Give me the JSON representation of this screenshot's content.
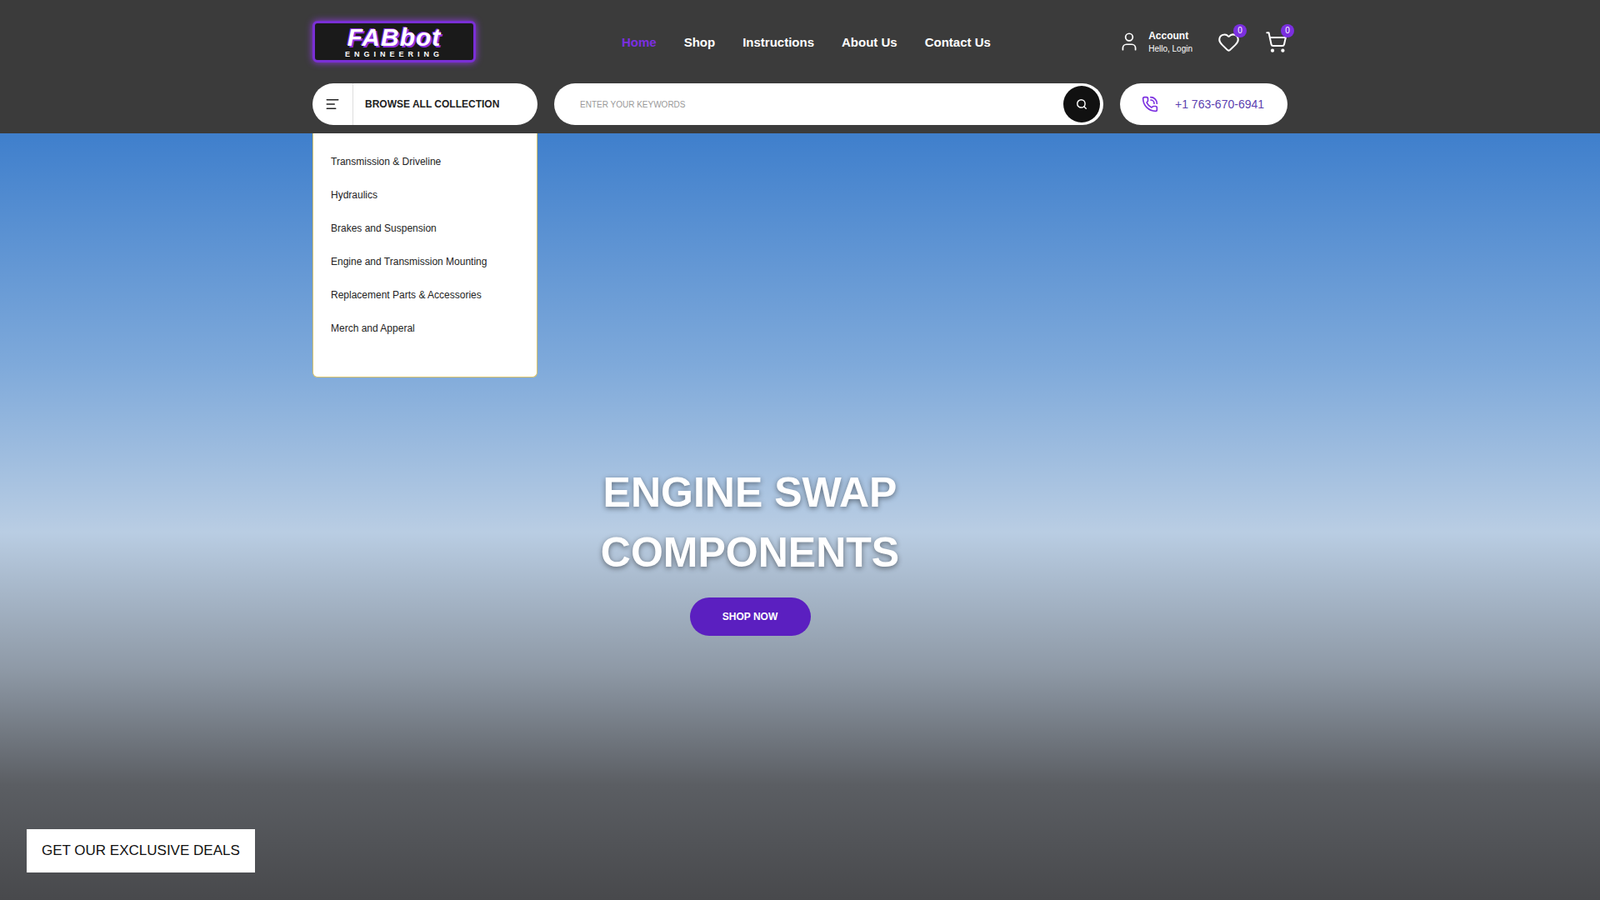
{
  "logo": {
    "text": "FABbot",
    "subtitle": "ENGINEERING"
  },
  "nav": [
    {
      "label": "Home",
      "selected": true
    },
    {
      "label": "Shop",
      "selected": false
    },
    {
      "label": "Instructions",
      "selected": false
    },
    {
      "label": "About Us",
      "selected": false
    },
    {
      "label": "Contact Us",
      "selected": false
    }
  ],
  "account": {
    "title": "Account",
    "subtitle": "Hello, Login"
  },
  "wishlist": {
    "count": "0"
  },
  "cart": {
    "count": "0"
  },
  "browse": {
    "label": "BROWSE ALL COLLECTION",
    "expanded": true,
    "items": [
      "Transmission & Driveline",
      "Hydraulics",
      "Brakes and Suspension",
      "Engine and Transmission Mounting",
      "Replacement Parts & Accessories",
      "Merch and Apperal"
    ]
  },
  "search": {
    "placeholder": "ENTER YOUR KEYWORDS"
  },
  "phone": "+1 763-670-6941",
  "hero": {
    "lines": [
      "ENGINE SWAP",
      "COMPONENTS"
    ],
    "button": "SHOP NOW"
  },
  "deals": "GET OUR EXCLUSIVE DEALS"
}
